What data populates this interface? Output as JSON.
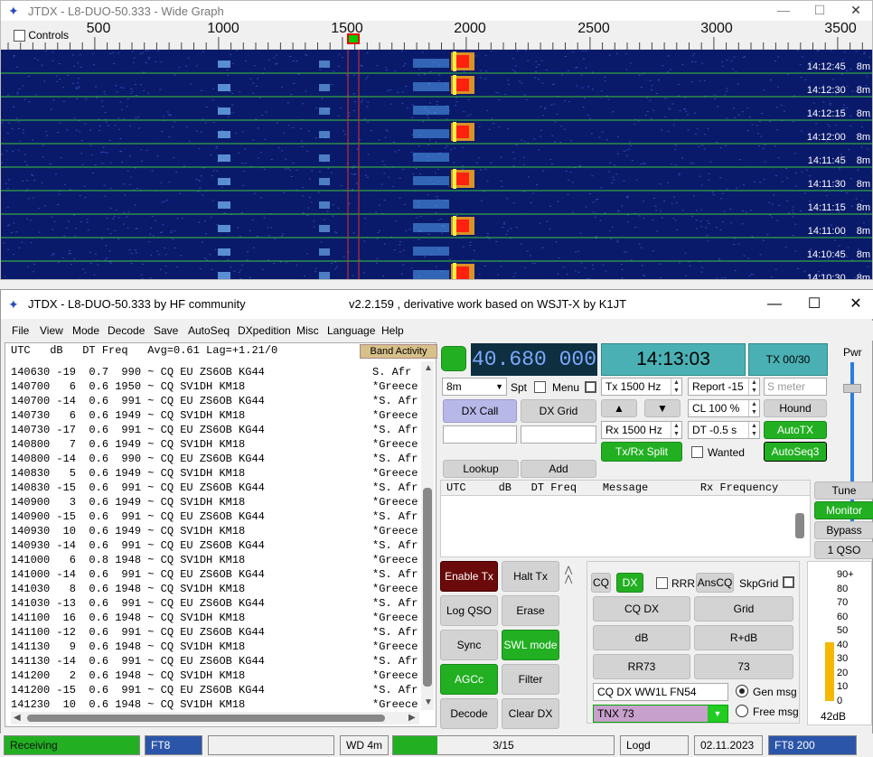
{
  "wide_graph": {
    "title": "JTDX - L8-DUO-50.333 - Wide Graph",
    "controls_label": "Controls",
    "freq_ticks": [
      "500",
      "1000",
      "1500",
      "2000",
      "2500",
      "3000",
      "3500"
    ],
    "timestamps": [
      "14:12:45",
      "14:12:30",
      "14:12:15",
      "14:12:00",
      "14:11:45",
      "14:11:30",
      "14:11:15",
      "14:11:00",
      "14:10:45",
      "14:10:30"
    ],
    "band_suffix": "8m"
  },
  "main": {
    "title": "JTDX - L8-DUO-50.333  by HF community",
    "subtitle": "v2.2.159 , derivative work based on WSJT-X by K1JT",
    "menu": [
      "File",
      "View",
      "Mode",
      "Decode",
      "Save",
      "AutoSeq",
      "DXpedition",
      "Misc",
      "Language",
      "Help"
    ],
    "decode_header": "UTC   dB   DT Freq   Avg=0.61 Lag=+1.21/0",
    "band_activity": "Band Activity",
    "decodes": [
      {
        "t": "140630 -19  0.7  990 ~ CQ EU ZS6OB KG44",
        "c": "S. Afr"
      },
      {
        "t": "140700   6  0.6 1950 ~ CQ SV1DH KM18",
        "c": "*Greece"
      },
      {
        "t": "140700 -14  0.6  991 ~ CQ EU ZS6OB KG44",
        "c": "*S. Afr"
      },
      {
        "t": "140730   6  0.6 1949 ~ CQ SV1DH KM18",
        "c": "*Greece"
      },
      {
        "t": "140730 -17  0.6  991 ~ CQ EU ZS6OB KG44",
        "c": "*S. Afr"
      },
      {
        "t": "140800   7  0.6 1949 ~ CQ SV1DH KM18",
        "c": "*Greece"
      },
      {
        "t": "140800 -14  0.6  990 ~ CQ EU ZS6OB KG44",
        "c": "*S. Afr"
      },
      {
        "t": "140830   5  0.6 1949 ~ CQ SV1DH KM18",
        "c": "*Greece"
      },
      {
        "t": "140830 -15  0.6  991 ~ CQ EU ZS6OB KG44",
        "c": "*S. Afr"
      },
      {
        "t": "140900   3  0.6 1949 ~ CQ SV1DH KM18",
        "c": "*Greece"
      },
      {
        "t": "140900 -15  0.6  991 ~ CQ EU ZS6OB KG44",
        "c": "*S. Afr"
      },
      {
        "t": "140930  10  0.6 1949 ~ CQ SV1DH KM18",
        "c": "*Greece"
      },
      {
        "t": "140930 -14  0.6  991 ~ CQ EU ZS6OB KG44",
        "c": "*S. Afr"
      },
      {
        "t": "141000   6  0.8 1948 ~ CQ SV1DH KM18",
        "c": "*Greece"
      },
      {
        "t": "141000 -14  0.6  991 ~ CQ EU ZS6OB KG44",
        "c": "*S. Afr"
      },
      {
        "t": "141030   8  0.6 1948 ~ CQ SV1DH KM18",
        "c": "*Greece"
      },
      {
        "t": "141030 -13  0.6  991 ~ CQ EU ZS6OB KG44",
        "c": "*S. Afr"
      },
      {
        "t": "141100  16  0.6 1948 ~ CQ SV1DH KM18",
        "c": "*Greece"
      },
      {
        "t": "141100 -12  0.6  991 ~ CQ EU ZS6OB KG44",
        "c": "*S. Afr"
      },
      {
        "t": "141130   9  0.6 1948 ~ CQ SV1DH KM18",
        "c": "*Greece"
      },
      {
        "t": "141130 -14  0.6  991 ~ CQ EU ZS6OB KG44",
        "c": "*S. Afr"
      },
      {
        "t": "141200   2  0.6 1948 ~ CQ SV1DH KM18",
        "c": "*Greece"
      },
      {
        "t": "141200 -15  0.6  991 ~ CQ EU ZS6OB KG44",
        "c": "*S. Afr"
      },
      {
        "t": "141230  10  0.6 1948 ~ CQ SV1DH KM18",
        "c": "*Greece"
      }
    ],
    "freq_display": "40.680 000",
    "clock": "14:13:03",
    "tx_period": "TX 00/30",
    "pwr_label": "Pwr",
    "band": "8m",
    "spt": "Spt",
    "menu_chk": "Menu",
    "dx_call": "DX Call",
    "dx_grid": "DX Grid",
    "tx_hz": "Tx  1500  Hz",
    "rx_hz": "Rx  1500  Hz",
    "report": "Report -15",
    "s_meter": "S meter",
    "cl": "CL  100 %",
    "dt": "DT -0.5 s",
    "hound": "Hound",
    "autotx": "AutoTX",
    "autoseq3": "AutoSeq3",
    "txrx_split": "Tx/Rx Split",
    "wanted": "Wanted",
    "lookup": "Lookup",
    "add": "Add",
    "rx_header": "UTC     dB   DT Freq    Message        Rx Frequency",
    "tune": "Tune",
    "monitor": "Monitor",
    "bypass": "Bypass",
    "one_qso": "1 QSO",
    "enable_tx": "Enable Tx",
    "halt_tx": "Halt Tx",
    "log_qso": "Log QSO",
    "erase": "Erase",
    "sync": "Sync",
    "swl_mode": "SWL mode",
    "agcc": "AGCc",
    "filter": "Filter",
    "decode": "Decode",
    "clear_dx": "Clear DX",
    "cq": "CQ",
    "dx": "DX",
    "rrr": "RRR",
    "anscq": "AnsCQ",
    "skpgrid": "SkpGrid",
    "cq_dx": "CQ DX",
    "grid": "Grid",
    "db": "dB",
    "r_db": "R+dB",
    "rr73": "RR73",
    "n73": "73",
    "cq_msg": "CQ DX WW1L FN54",
    "tnx_msg": "TNX 73",
    "gen_msg": "Gen msg",
    "free_msg": "Free msg",
    "meter_ticks": [
      "90+",
      "80",
      "70",
      "60",
      "50",
      "40",
      "30",
      "20",
      "10",
      "0"
    ],
    "meter_level_db": 42,
    "meter_value": "42dB",
    "status": {
      "receiving": "Receiving",
      "mode": "FT8",
      "wd": "WD 4m",
      "progress": "3/15",
      "progress_fraction": 0.2,
      "logd": "Logd",
      "date": "02.11.2023",
      "mode_right": "FT8  200"
    }
  }
}
